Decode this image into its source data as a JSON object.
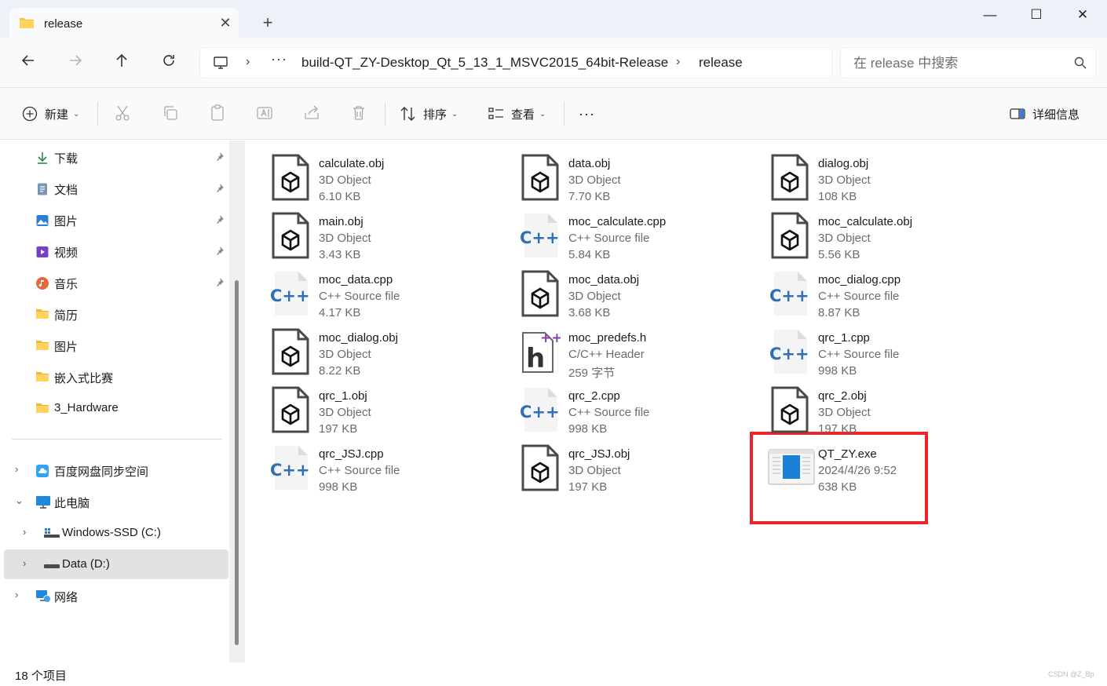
{
  "window": {
    "tab_title": "release",
    "tab_close": "✕",
    "new_tab": "+",
    "minimize": "—",
    "maximize": "☐",
    "close": "✕"
  },
  "address": {
    "crumbs": [
      "build-QT_ZY-Desktop_Qt_5_13_1_MSVC2015_64bit-Release",
      "release"
    ],
    "ellipsis": "···",
    "search_placeholder": "在 release 中搜索"
  },
  "toolbar": {
    "new_label": "新建",
    "sort_label": "排序",
    "view_label": "查看",
    "more_label": "···",
    "details_label": "详细信息"
  },
  "sidebar": {
    "quick_access": [
      {
        "label": "下载",
        "icon": "download-icon",
        "pinned": true
      },
      {
        "label": "文档",
        "icon": "document-icon",
        "pinned": true
      },
      {
        "label": "图片",
        "icon": "pictures-icon",
        "pinned": true
      },
      {
        "label": "视频",
        "icon": "videos-icon",
        "pinned": true
      },
      {
        "label": "音乐",
        "icon": "music-icon",
        "pinned": true
      },
      {
        "label": "简历",
        "icon": "folder-icon",
        "pinned": false
      },
      {
        "label": "图片",
        "icon": "folder-icon",
        "pinned": false
      },
      {
        "label": "嵌入式比赛",
        "icon": "folder-icon",
        "pinned": false
      },
      {
        "label": "3_Hardware",
        "icon": "folder-icon",
        "pinned": false
      }
    ],
    "tree": [
      {
        "label": "百度网盘同步空间",
        "icon": "cloud-drive-icon",
        "expander": "›"
      },
      {
        "label": "此电脑",
        "icon": "this-pc-icon",
        "expander": "⌄"
      },
      {
        "label": "Windows-SSD (C:)",
        "icon": "drive-c-icon",
        "expander": "›"
      },
      {
        "label": "Data (D:)",
        "icon": "drive-d-icon",
        "expander": "›",
        "selected": true
      },
      {
        "label": "网络",
        "icon": "network-icon",
        "expander": "›"
      }
    ]
  },
  "files": [
    {
      "name": "calculate.obj",
      "type": "3D Object",
      "size": "6.10 KB",
      "icon": "3d-object-icon"
    },
    {
      "name": "data.obj",
      "type": "3D Object",
      "size": "7.70 KB",
      "icon": "3d-object-icon"
    },
    {
      "name": "dialog.obj",
      "type": "3D Object",
      "size": "108 KB",
      "icon": "3d-object-icon"
    },
    {
      "name": "main.obj",
      "type": "3D Object",
      "size": "3.43 KB",
      "icon": "3d-object-icon"
    },
    {
      "name": "moc_calculate.cpp",
      "type": "C++ Source file",
      "size": "5.84 KB",
      "icon": "cpp-file-icon"
    },
    {
      "name": "moc_calculate.obj",
      "type": "3D Object",
      "size": "5.56 KB",
      "icon": "3d-object-icon"
    },
    {
      "name": "moc_data.cpp",
      "type": "C++ Source file",
      "size": "4.17 KB",
      "icon": "cpp-file-icon"
    },
    {
      "name": "moc_data.obj",
      "type": "3D Object",
      "size": "3.68 KB",
      "icon": "3d-object-icon"
    },
    {
      "name": "moc_dialog.cpp",
      "type": "C++ Source file",
      "size": "8.87 KB",
      "icon": "cpp-file-icon"
    },
    {
      "name": "moc_dialog.obj",
      "type": "3D Object",
      "size": "8.22 KB",
      "icon": "3d-object-icon"
    },
    {
      "name": "moc_predefs.h",
      "type": "C/C++ Header",
      "size": "259 字节",
      "icon": "header-file-icon"
    },
    {
      "name": "qrc_1.cpp",
      "type": "C++ Source file",
      "size": "998 KB",
      "icon": "cpp-file-icon"
    },
    {
      "name": "qrc_1.obj",
      "type": "3D Object",
      "size": "197 KB",
      "icon": "3d-object-icon"
    },
    {
      "name": "qrc_2.cpp",
      "type": "C++ Source file",
      "size": "998 KB",
      "icon": "cpp-file-icon"
    },
    {
      "name": "qrc_2.obj",
      "type": "3D Object",
      "size": "197 KB",
      "icon": "3d-object-icon"
    },
    {
      "name": "qrc_JSJ.cpp",
      "type": "C++ Source file",
      "size": "998 KB",
      "icon": "cpp-file-icon"
    },
    {
      "name": "qrc_JSJ.obj",
      "type": "3D Object",
      "size": "197 KB",
      "icon": "3d-object-icon"
    },
    {
      "name": "QT_ZY.exe",
      "type": "2024/4/26 9:52",
      "size": "638 KB",
      "icon": "exe-file-icon",
      "highlighted": true
    }
  ],
  "status": {
    "item_count": "18 个项目",
    "watermark": "CSDN @Z_Bp"
  },
  "colors": {
    "highlight": "#e8262b",
    "titlebar": "#eef1f7",
    "toolbar": "#f9fafc",
    "selected": "#e2e2e2",
    "cpp_blue": "#2e6fb5"
  }
}
